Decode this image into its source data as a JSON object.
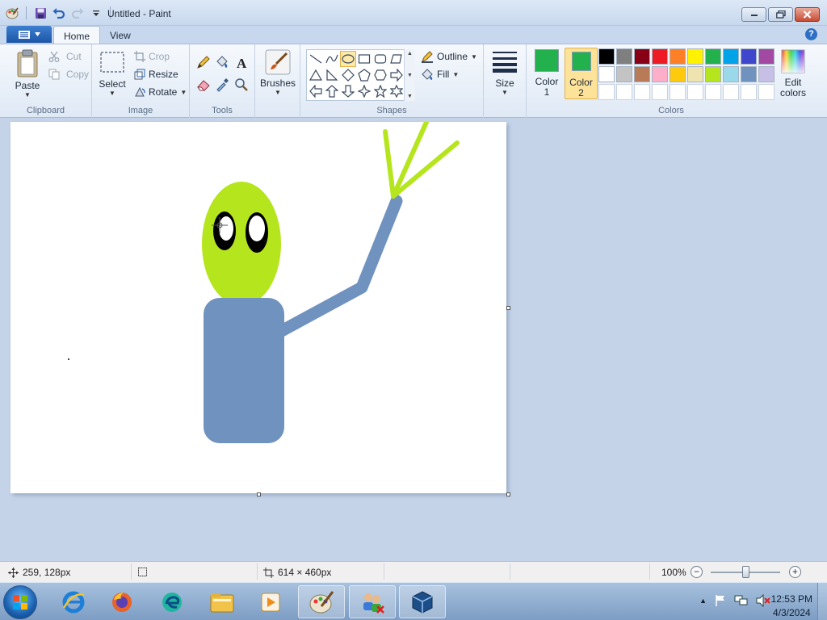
{
  "window": {
    "title": "Untitled - Paint"
  },
  "tabs": [
    {
      "label": "Home",
      "active": true
    },
    {
      "label": "View",
      "active": false
    }
  ],
  "ribbon": {
    "clipboard": {
      "group_label": "Clipboard",
      "paste": "Paste",
      "cut": "Cut",
      "copy": "Copy"
    },
    "image": {
      "group_label": "Image",
      "select": "Select",
      "crop": "Crop",
      "resize": "Resize",
      "rotate": "Rotate"
    },
    "tools": {
      "group_label": "Tools"
    },
    "brushes": {
      "label": "Brushes"
    },
    "shapes": {
      "group_label": "Shapes",
      "outline": "Outline",
      "fill": "Fill"
    },
    "size": {
      "label": "Size"
    },
    "colors": {
      "group_label": "Colors",
      "color1": {
        "label_line1": "Color",
        "label_line2": "1",
        "value": "#22b14c"
      },
      "color2": {
        "label_line1": "Color",
        "label_line2": "2",
        "value": "#22b14c",
        "selected": true
      },
      "edit_colors_line1": "Edit",
      "edit_colors_line2": "colors",
      "palette": [
        "#000000",
        "#7f7f7f",
        "#880015",
        "#ed1c24",
        "#ff7f27",
        "#fff200",
        "#22b14c",
        "#00a2e8",
        "#3f48cc",
        "#a349a4",
        "#ffffff",
        "#c3c3c3",
        "#b97a57",
        "#ffaec9",
        "#ffc90e",
        "#efe4b0",
        "#b5e61d",
        "#99d9ea",
        "#7092be",
        "#c8bfe7",
        "#ffffff",
        "#ffffff",
        "#ffffff",
        "#ffffff",
        "#ffffff",
        "#ffffff",
        "#ffffff",
        "#ffffff",
        "#ffffff",
        "#ffffff"
      ]
    }
  },
  "canvas": {
    "drawing_colors": {
      "head": "#b5e61d",
      "body": "#7092be",
      "eye_outer": "#000000",
      "eye_inner": "#ffffff"
    }
  },
  "status": {
    "cursor_position": "259, 128px",
    "canvas_size": "614 × 460px",
    "zoom": "100%",
    "zoom_level": 100
  },
  "taskbar": {
    "items": [
      "internet-explorer",
      "firefox",
      "edge",
      "file-explorer",
      "media-player",
      "paint",
      "network-tool",
      "virtualbox"
    ],
    "clock_time": "12:53 PM",
    "clock_date": "4/3/2024"
  }
}
